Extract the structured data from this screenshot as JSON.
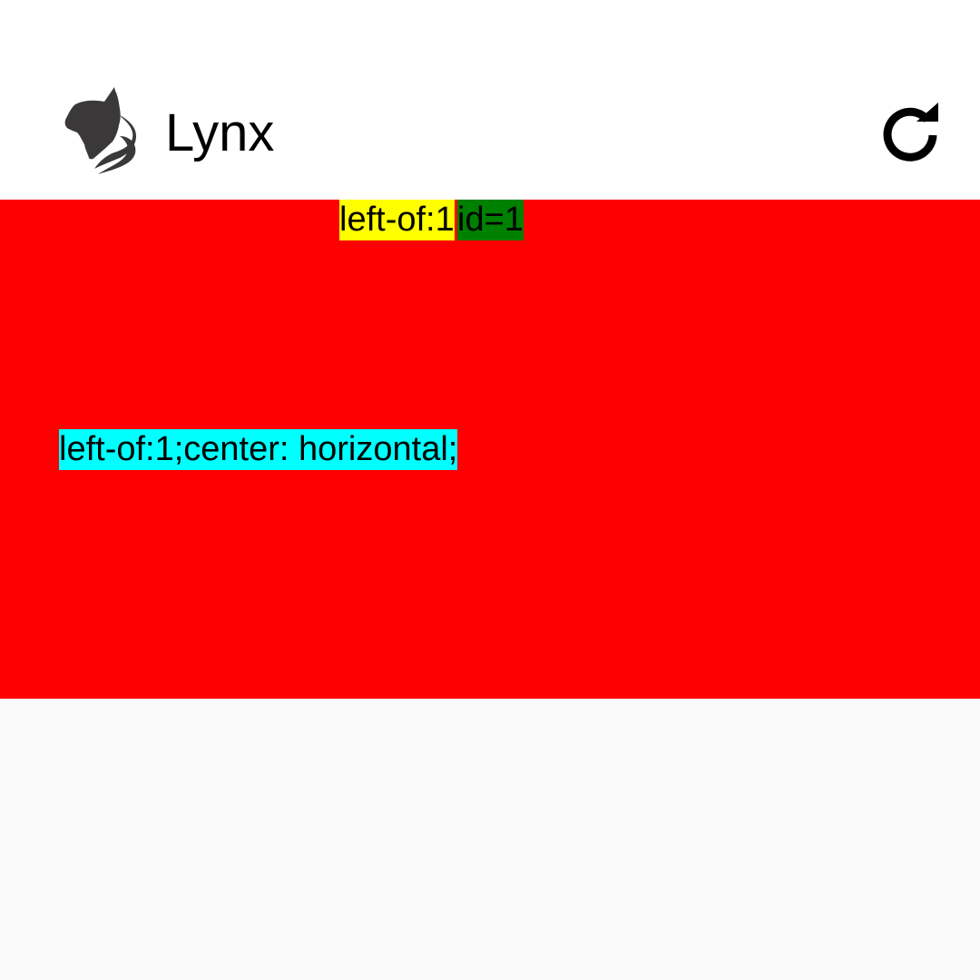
{
  "header": {
    "title": "Lynx",
    "logo_icon": "lynx-cat-logo-icon",
    "refresh_icon": "refresh-icon",
    "background": "#ffffff"
  },
  "canvas": {
    "background": "#ff0000",
    "labels": [
      {
        "text": "left-of:1",
        "background": "#ffff00"
      },
      {
        "text": "id=1",
        "background": "#008000"
      },
      {
        "text": "left-of:1;center: horizontal;",
        "background": "#00ffff"
      }
    ]
  },
  "page": {
    "background": "#f9f9f9"
  }
}
